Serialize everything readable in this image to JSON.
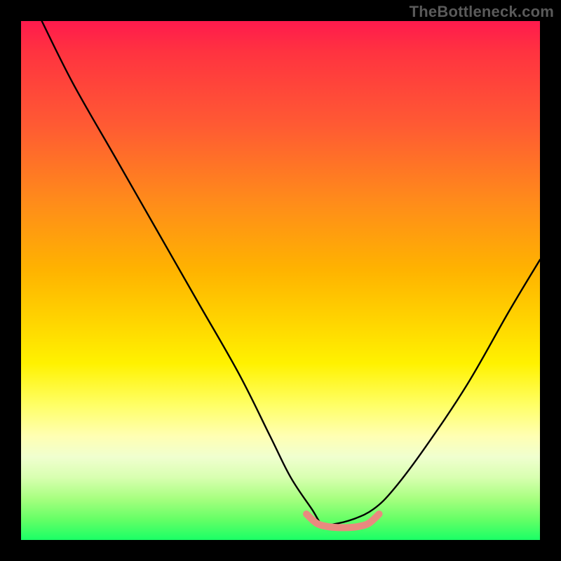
{
  "watermark": {
    "text": "TheBottleneck.com"
  },
  "chart_data": {
    "type": "line",
    "title": "",
    "xlabel": "",
    "ylabel": "",
    "xlim": [
      0,
      100
    ],
    "ylim": [
      0,
      100
    ],
    "grid": false,
    "legend": false,
    "notes": "Background is a vertical heatmap gradient from red (top, high bottleneck / bad) to green (bottom, optimal). Black curve shows bottleneck severity vs. component ratio, dipping to a minimum at the sweet spot. Salmon segment marks the low-bottleneck range.",
    "gradient_stops": [
      {
        "pos": 0,
        "color": "#ff1a4d"
      },
      {
        "pos": 20,
        "color": "#ff5a33"
      },
      {
        "pos": 48,
        "color": "#ffd500"
      },
      {
        "pos": 74,
        "color": "#ffff66"
      },
      {
        "pos": 88,
        "color": "#d8ffb0"
      },
      {
        "pos": 100,
        "color": "#1aff66"
      }
    ],
    "series": [
      {
        "name": "bottleneck-curve",
        "stroke": "#000000",
        "x": [
          4,
          10,
          18,
          26,
          34,
          42,
          48,
          52,
          56,
          58,
          60,
          64,
          68,
          72,
          78,
          86,
          94,
          100
        ],
        "y": [
          100,
          88,
          74,
          60,
          46,
          32,
          20,
          12,
          6,
          3,
          3,
          4,
          6,
          10,
          18,
          30,
          44,
          54
        ]
      },
      {
        "name": "sweet-spot-band",
        "stroke": "#e98a7f",
        "x": [
          55,
          57,
          59,
          61,
          63,
          65,
          67,
          69
        ],
        "y": [
          5,
          3.2,
          2.6,
          2.4,
          2.4,
          2.6,
          3.2,
          5
        ]
      }
    ]
  }
}
